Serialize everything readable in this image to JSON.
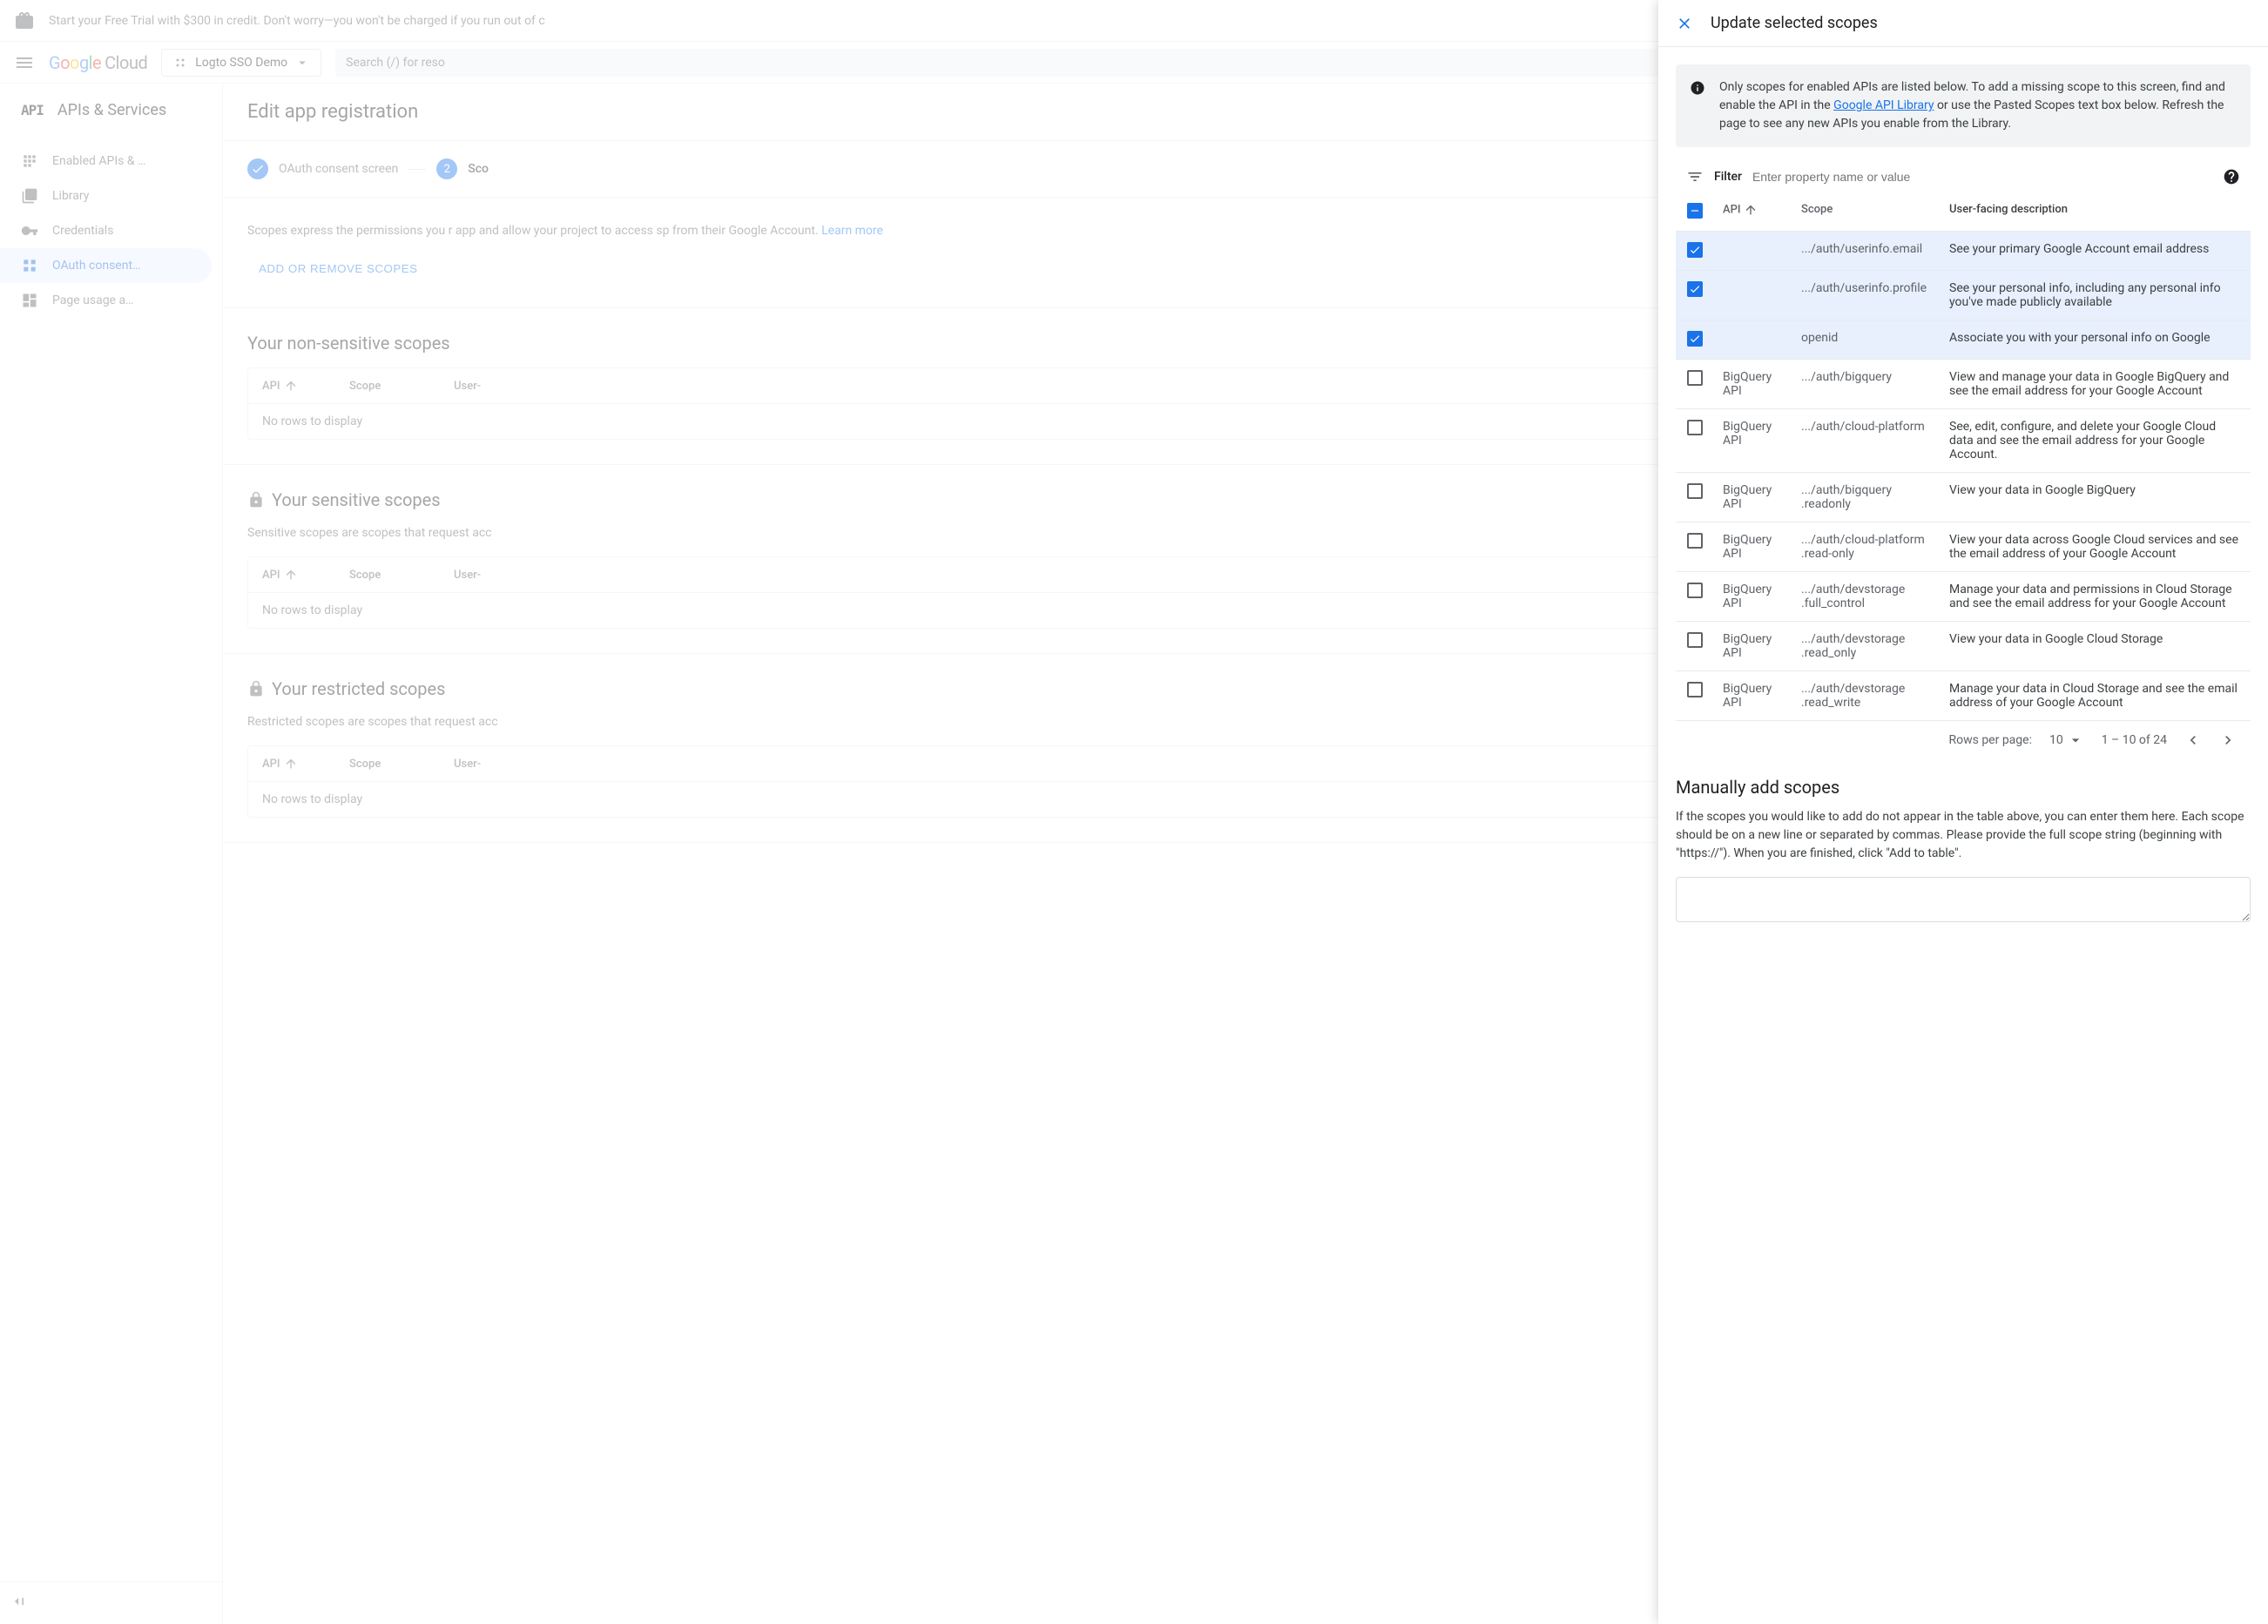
{
  "top_banner": {
    "text": "Start your Free Trial with $300 in credit. Don't worry—you won't be charged if you run out of c"
  },
  "header": {
    "logo_cloud": "Cloud",
    "project_name": "Logto SSO Demo",
    "search_placeholder": "Search (/) for reso"
  },
  "sidebar": {
    "title": "APIs & Services",
    "items": [
      {
        "label": "Enabled APIs & …",
        "id": "enabled-apis"
      },
      {
        "label": "Library",
        "id": "library"
      },
      {
        "label": "Credentials",
        "id": "credentials"
      },
      {
        "label": "OAuth consent…",
        "id": "oauth-consent",
        "active": true
      },
      {
        "label": "Page usage a…",
        "id": "page-usage"
      }
    ]
  },
  "content": {
    "title": "Edit app registration",
    "step1": "OAuth consent screen",
    "step2_num": "2",
    "step2": "Sco",
    "intro": "Scopes express the permissions you r app and allow your project to access sp from their Google Account. ",
    "learn_more": "Learn more",
    "add_scopes_btn": "ADD OR REMOVE SCOPES",
    "non_sensitive_title": "Your non-sensitive scopes",
    "sensitive_title": "Your sensitive scopes",
    "sensitive_desc": "Sensitive scopes are scopes that request acc",
    "restricted_title": "Your restricted scopes",
    "restricted_desc": "Restricted scopes are scopes that request acc",
    "col_api": "API",
    "col_scope": "Scope",
    "col_desc": "User-",
    "no_rows": "No rows to display"
  },
  "panel": {
    "title": "Update selected scopes",
    "info_text_1": "Only scopes for enabled APIs are listed below. To add a missing scope to this screen, find and enable the API in the ",
    "info_link": "Google API Library",
    "info_text_2": " or use the Pasted Scopes text box below. Refresh the page to see any new APIs you enable from the Library.",
    "filter_label": "Filter",
    "filter_placeholder": "Enter property name or value",
    "col_api": "API",
    "col_scope": "Scope",
    "col_desc": "User-facing description",
    "rows": [
      {
        "checked": true,
        "api": "",
        "scope": ".../auth/userinfo.email",
        "desc": "See your primary Google Account email address"
      },
      {
        "checked": true,
        "api": "",
        "scope": ".../auth/userinfo.profile",
        "desc": "See your personal info, including any personal info you've made publicly available"
      },
      {
        "checked": true,
        "api": "",
        "scope": "openid",
        "desc": "Associate you with your personal info on Google"
      },
      {
        "checked": false,
        "api": "BigQuery API",
        "scope": ".../auth/bigquery",
        "desc": "View and manage your data in Google BigQuery and see the email address for your Google Account"
      },
      {
        "checked": false,
        "api": "BigQuery API",
        "scope": ".../auth/cloud-platform",
        "desc": "See, edit, configure, and delete your Google Cloud data and see the email address for your Google Account."
      },
      {
        "checked": false,
        "api": "BigQuery API",
        "scope": ".../auth/bigquery .readonly",
        "desc": "View your data in Google BigQuery"
      },
      {
        "checked": false,
        "api": "BigQuery API",
        "scope": ".../auth/cloud-platform .read-only",
        "desc": "View your data across Google Cloud services and see the email address of your Google Account"
      },
      {
        "checked": false,
        "api": "BigQuery API",
        "scope": ".../auth/devstorage .full_control",
        "desc": "Manage your data and permissions in Cloud Storage and see the email address for your Google Account"
      },
      {
        "checked": false,
        "api": "BigQuery API",
        "scope": ".../auth/devstorage .read_only",
        "desc": "View your data in Google Cloud Storage"
      },
      {
        "checked": false,
        "api": "BigQuery API",
        "scope": ".../auth/devstorage .read_write",
        "desc": "Manage your data in Cloud Storage and see the email address of your Google Account"
      }
    ],
    "rows_per_page_label": "Rows per page:",
    "rows_per_page_value": "10",
    "page_range": "1 – 10 of 24",
    "manual_title": "Manually add scopes",
    "manual_desc": "If the scopes you would like to add do not appear in the table above, you can enter them here. Each scope should be on a new line or separated by commas. Please provide the full scope string (beginning with \"https://\"). When you are finished, click \"Add to table\"."
  }
}
